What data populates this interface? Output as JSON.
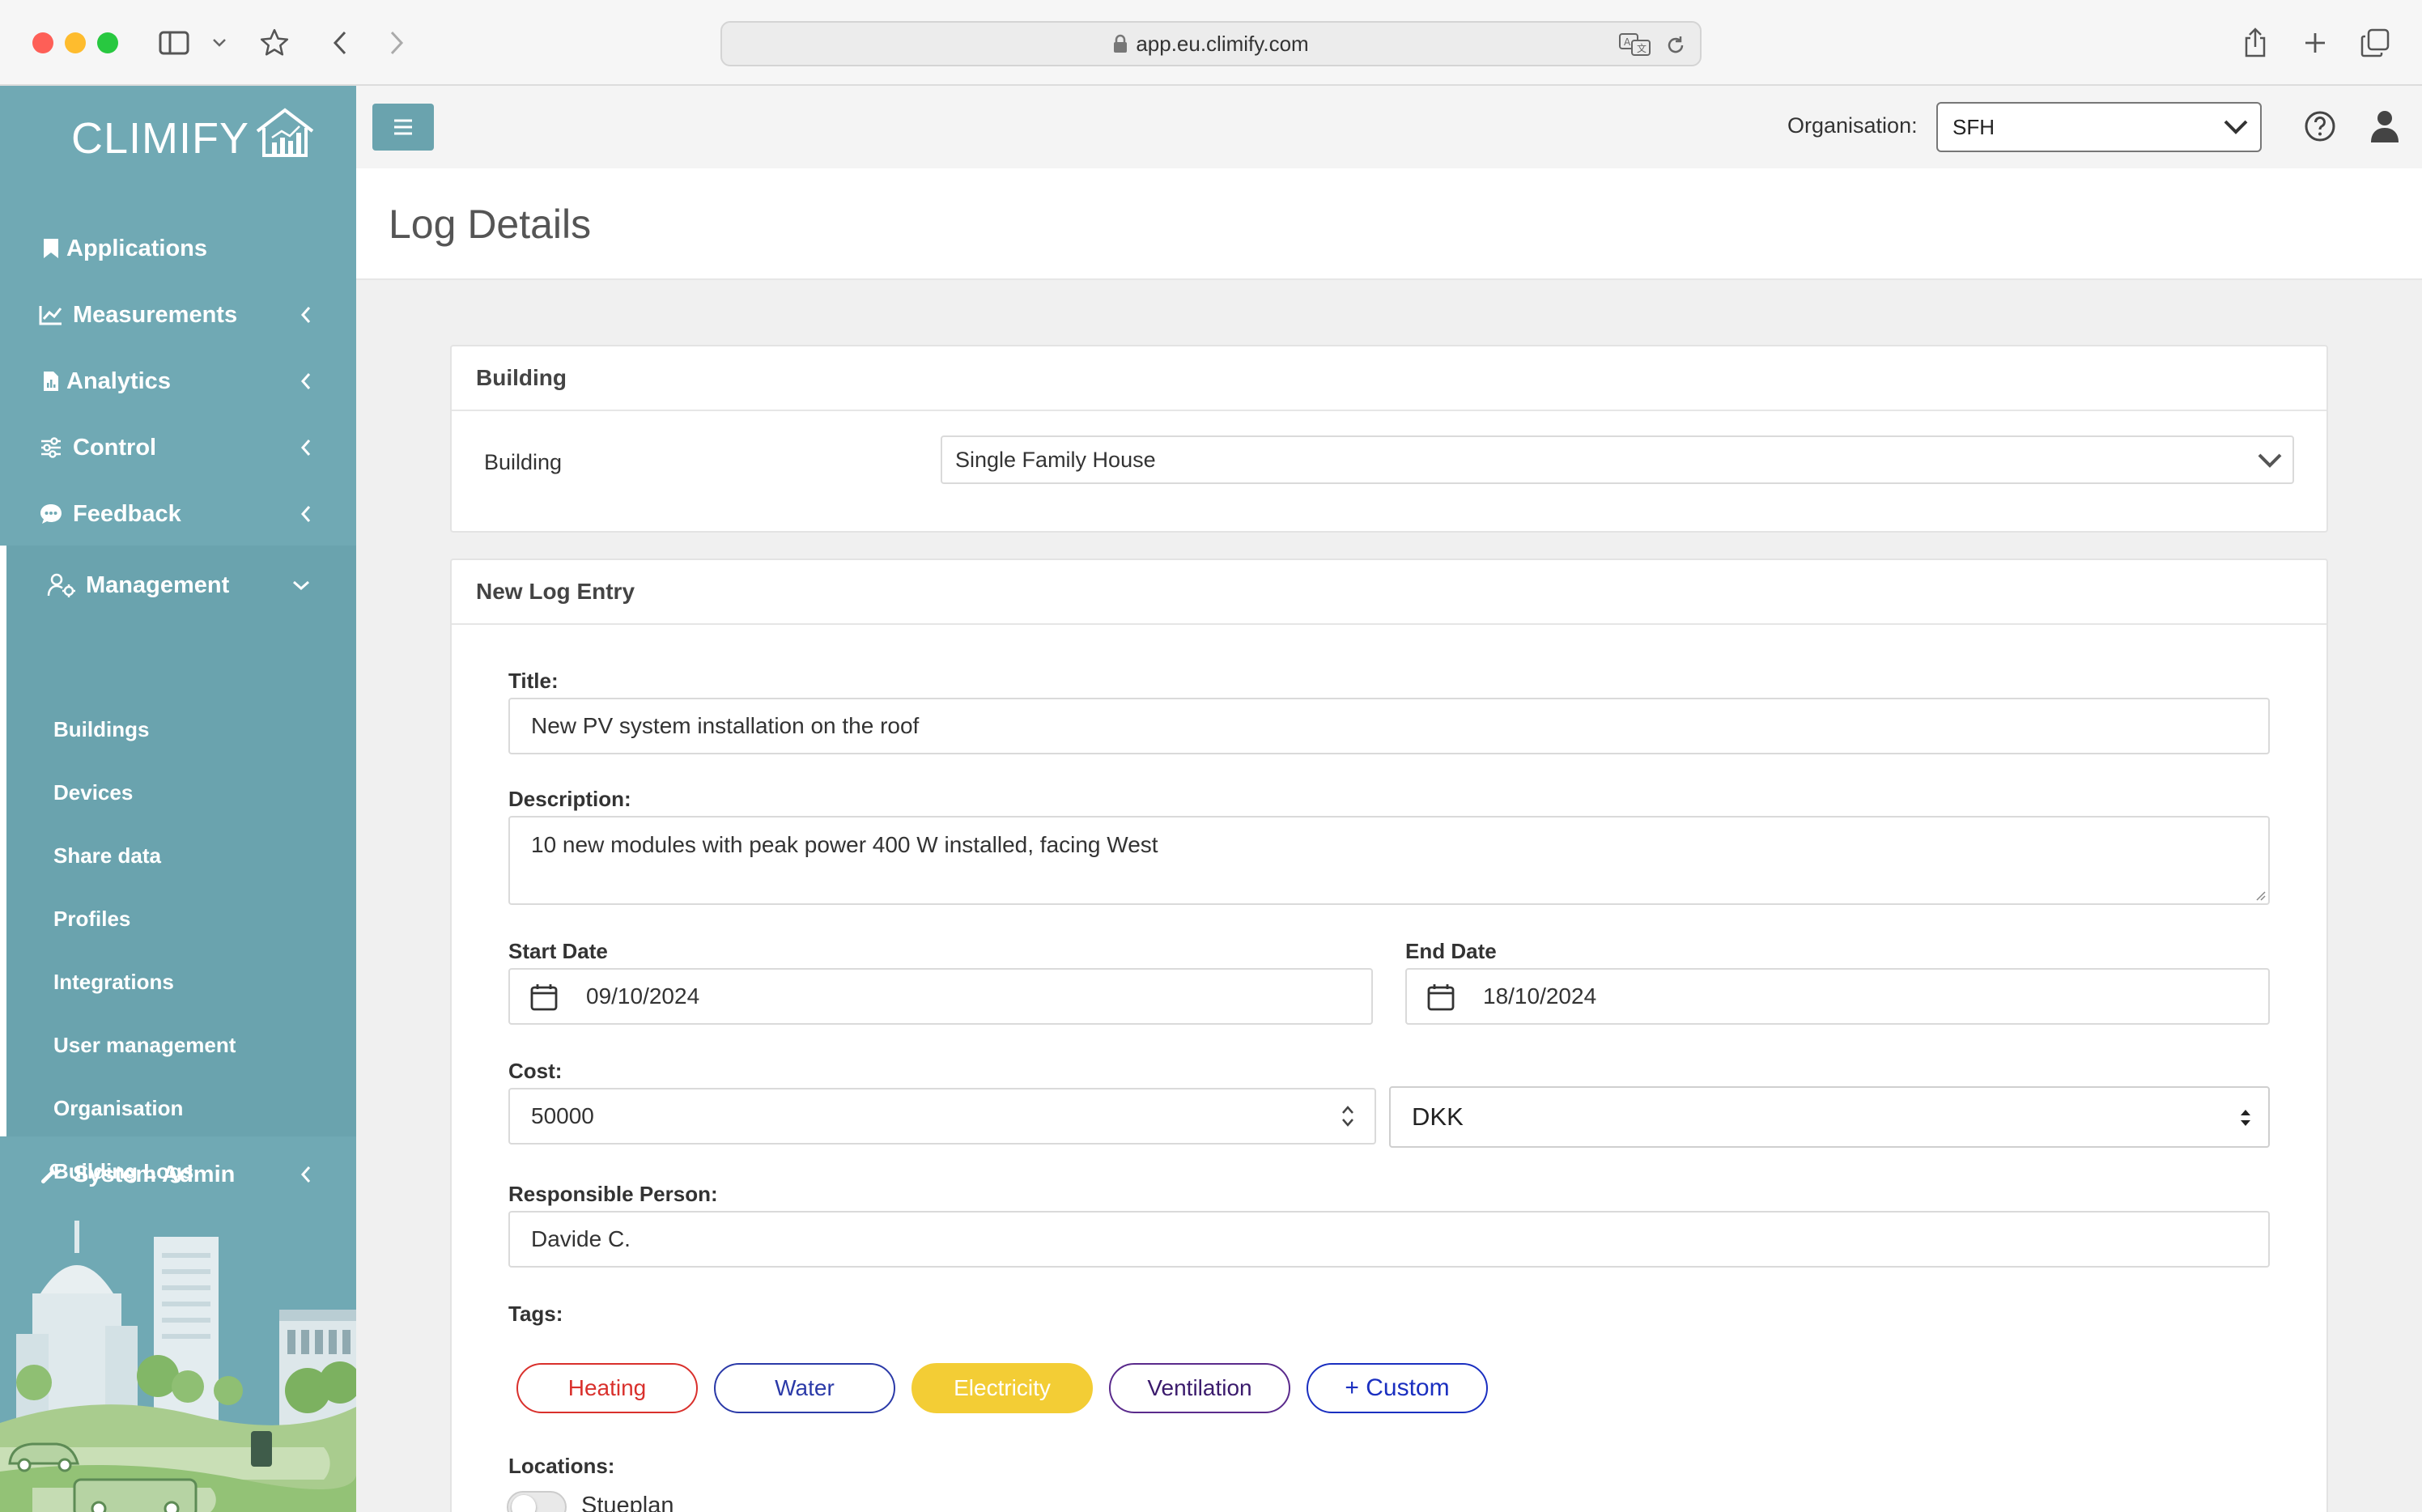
{
  "browser": {
    "url": "app.eu.climify.com"
  },
  "sidebar": {
    "logo_text": "CLIMIFY",
    "nav": [
      {
        "label": "Applications"
      },
      {
        "label": "Measurements"
      },
      {
        "label": "Analytics"
      },
      {
        "label": "Control"
      },
      {
        "label": "Feedback"
      },
      {
        "label": "Management"
      }
    ],
    "management_items": [
      {
        "label": "Buildings"
      },
      {
        "label": "Devices"
      },
      {
        "label": "Share data"
      },
      {
        "label": "Profiles"
      },
      {
        "label": "Integrations"
      },
      {
        "label": "User management"
      },
      {
        "label": "Organisation"
      },
      {
        "label": "Building Logs"
      }
    ],
    "system_admin": {
      "label": "System Admin"
    }
  },
  "topbar": {
    "organisation_label": "Organisation:",
    "organisation_value": "SFH"
  },
  "page": {
    "title": "Log Details"
  },
  "building_card": {
    "header": "Building",
    "field_label": "Building",
    "selected": "Single Family House"
  },
  "log_card": {
    "header": "New Log Entry",
    "title_label": "Title:",
    "title_value": "New PV system installation on the roof",
    "description_label": "Description:",
    "description_value": "10 new modules with peak power 400 W installed, facing West",
    "start_date_label": "Start Date",
    "start_date_value": "09/10/2024",
    "end_date_label": "End Date",
    "end_date_value": "18/10/2024",
    "cost_label": "Cost:",
    "cost_value": "50000",
    "currency_value": "DKK",
    "responsible_label": "Responsible Person:",
    "responsible_value": "Davide C.",
    "tags_label": "Tags:",
    "tags": [
      {
        "label": "Heating",
        "color": "#d9302c"
      },
      {
        "label": "Water",
        "color": "#2b3aa8"
      },
      {
        "label": "Electricity",
        "color": "#f3cd35"
      },
      {
        "label": "Ventilation",
        "color": "#5a2a8c"
      },
      {
        "label": "+ Custom",
        "color": "#1a2fc0"
      }
    ],
    "locations_label": "Locations:",
    "locations": [
      {
        "label": "Stueplan"
      }
    ]
  },
  "colors": {
    "sidebar": "#70a9b4",
    "accent": "#6aa3ae"
  }
}
